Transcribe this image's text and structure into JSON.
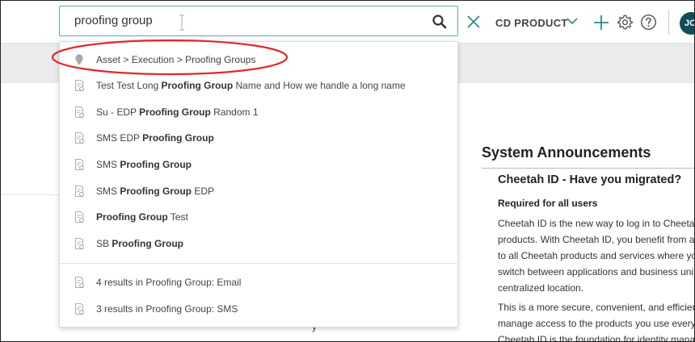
{
  "search": {
    "value": "proofing group",
    "placeholder": ""
  },
  "header": {
    "product_label": "CD PRODUCT",
    "avatar_initials": "JC"
  },
  "dropdown": {
    "items": [
      {
        "icon": "map-pin-icon",
        "segments": [
          {
            "t": "Asset > Execution > Proofing Groups",
            "b": false
          }
        ]
      },
      {
        "icon": "proofing-group-icon",
        "segments": [
          {
            "t": "Test Test Long ",
            "b": false
          },
          {
            "t": "Proofing Group",
            "b": true
          },
          {
            "t": " Name and How we handle a long name",
            "b": false
          }
        ]
      },
      {
        "icon": "proofing-group-icon",
        "segments": [
          {
            "t": "Su - EDP ",
            "b": false
          },
          {
            "t": "Proofing Group",
            "b": true
          },
          {
            "t": " Random 1",
            "b": false
          }
        ]
      },
      {
        "icon": "proofing-group-icon",
        "segments": [
          {
            "t": "SMS EDP ",
            "b": false
          },
          {
            "t": "Proofing Group",
            "b": true
          }
        ]
      },
      {
        "icon": "proofing-group-icon",
        "segments": [
          {
            "t": "SMS ",
            "b": false
          },
          {
            "t": "Proofing Group",
            "b": true
          }
        ]
      },
      {
        "icon": "proofing-group-icon",
        "segments": [
          {
            "t": "SMS ",
            "b": false
          },
          {
            "t": "Proofing Group",
            "b": true
          },
          {
            "t": " EDP",
            "b": false
          }
        ]
      },
      {
        "icon": "proofing-group-icon",
        "segments": [
          {
            "t": "Proofing Group",
            "b": true
          },
          {
            "t": " Test",
            "b": false
          }
        ]
      },
      {
        "icon": "proofing-group-icon",
        "segments": [
          {
            "t": "SB ",
            "b": false
          },
          {
            "t": "Proofing Group",
            "b": true
          }
        ]
      }
    ],
    "summaries": [
      {
        "icon": "proofing-group-icon",
        "label": "4 results in Proofing Group: Email"
      },
      {
        "icon": "proofing-group-icon",
        "label": "3 results in Proofing Group: SMS"
      }
    ]
  },
  "announcements": {
    "title": "System Announcements",
    "item_title": "Cheetah ID - Have you migrated?",
    "required": "Required for all users",
    "paragraph1_lines": [
      "Cheetah ID is the new way to log in to Cheetah",
      "products. With Cheetah ID, you benefit from a",
      "to all Cheetah products and services where yo",
      "switch between applications and business uni",
      "centralized location."
    ],
    "paragraph2_lines": [
      "This is a more secure, convenient, and efficien",
      "manage access to the products you use every",
      "Cheetah ID is the foundation for identity mana"
    ]
  },
  "background": {
    "stray_char": "y"
  },
  "colors": {
    "accent": "#2e8b8b",
    "oval": "#e0282b",
    "graybar": "#e9ebed",
    "avatar": "#0f4c5c"
  }
}
